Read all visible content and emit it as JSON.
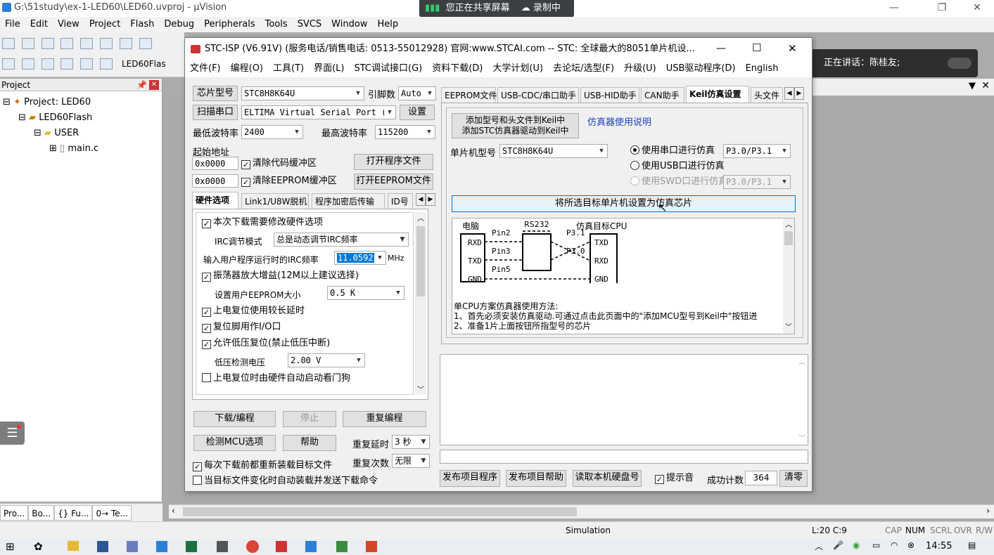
{
  "uvision": {
    "title": "G:\\51study\\ex-1-LED60\\LED60.uvproj - µVision",
    "menu": [
      "File",
      "Edit",
      "View",
      "Project",
      "Flash",
      "Debug",
      "Peripherals",
      "Tools",
      "SVCS",
      "Window",
      "Help"
    ],
    "target": "LED60Flas",
    "project_panel_title": "Project",
    "tree": [
      "Project: LED60",
      "LED60Flash",
      "USER",
      "main.c"
    ],
    "bottom_tabs": [
      "Pro...",
      "Bo...",
      "{} Fu...",
      "0→ Te..."
    ],
    "status": {
      "sim": "Simulation",
      "pos": "L:20 C:9",
      "keys": [
        "CAP",
        "NUM",
        "SCRL",
        "OVR",
        "R/W"
      ]
    }
  },
  "share": {
    "text": "您正在共享屏幕",
    "rec": "录制中"
  },
  "speaker": {
    "text": "正在讲话：陈桂友;"
  },
  "isp": {
    "title": "STC-ISP (V6.91V) (服务电话/销售电话: 0513-55012928) 官网:www.STCAI.com  -- STC: 全球最大的8051单片机设...",
    "menu": [
      "文件(F)",
      "编程(O)",
      "工具(T)",
      "界面(L)",
      "STC调试接口(G)",
      "资料下载(D)",
      "大学计划(U)",
      "去论坛/选型(F)",
      "升级(U)",
      "USB驱动程序(D)",
      "English"
    ],
    "chip_btn": "芯片型号",
    "chip": "STC8H8K64U",
    "pin_label": "引脚数",
    "pin": "Auto",
    "scan_btn": "扫描串口",
    "port": "ELTIMA Virtual Serial Port (CO",
    "settings_btn": "设置",
    "min_baud_label": "最低波特率",
    "min_baud": "2400",
    "max_baud_label": "最高波特率",
    "max_baud": "115200",
    "start_addr_label": "起始地址",
    "addr1": "0x0000",
    "clear_code": "清除代码缓冲区",
    "open_prog": "打开程序文件",
    "addr2": "0x0000",
    "clear_eeprom": "清除EEPROM缓冲区",
    "open_eeprom": "打开EEPROM文件",
    "left_tabs": [
      "硬件选项",
      "Link1/U8W脱机",
      "程序加密后传输",
      "ID号"
    ],
    "hw": {
      "opt1": "本次下载需要修改硬件选项",
      "irc_mode_label": "IRC调节模式",
      "irc_mode": "总是动态调节IRC频率",
      "irc_freq_label": "输入用户程序运行时的IRC频率",
      "irc_freq": "11.0592",
      "mhz": "MHz",
      "opt2": "振荡器放大增益(12M以上建议选择)",
      "eeprom_label": "设置用户EEPROM大小",
      "eeprom": "0.5 K",
      "opt3": "上电复位使用较长延时",
      "opt4": "复位脚用作I/O口",
      "opt5": "允许低压复位(禁止低压中断)",
      "lv_label": "低压检测电压",
      "lv": "2.00 V",
      "opt6": "上电复位时由硬件自动启动看门狗"
    },
    "download_btn": "下载/编程",
    "stop_btn": "停止",
    "reprog_btn": "重复编程",
    "detect_btn": "检测MCU选项",
    "help_btn": "帮助",
    "delay_label": "重复延时",
    "delay": "3 秒",
    "count_label": "重复次数",
    "count": "无限",
    "reload1": "每次下载前都重新装载目标文件",
    "reload2": "当目标文件变化时自动装载并发送下载命令",
    "right_tabs": [
      "EEPROM文件",
      "USB-CDC/串口助手",
      "USB-HID助手",
      "CAN助手",
      "Keil仿真设置",
      "头文件"
    ],
    "keil": {
      "add_btn_l1": "添加型号和头文件到Keil中",
      "add_btn_l2": "添加STC仿真器驱动到Keil中",
      "manual_link": "仿真器使用说明",
      "mcu_label": "单片机型号",
      "mcu": "STC8H8K64U",
      "r1": "使用串口进行仿真",
      "r1_port": "P3.0/P3.1",
      "r2": "使用USB口进行仿真",
      "r3": "使用SWD口进行仿真",
      "r3_port": "P3.0/P3.1",
      "set_btn": "将所选目标单片机设置为仿真芯片",
      "diag": {
        "pc": "电脑",
        "rs232": "RS232",
        "cpu": "仿真目标CPU",
        "rxd": "RXD",
        "txd": "TXD",
        "gnd": "GND",
        "pin2": "Pin2",
        "pin3": "Pin3",
        "pin5": "Pin5",
        "p31": "P3.1",
        "p30": "P3.0"
      },
      "note_title": "单CPU方案仿真器使用方法:",
      "note1": "1、首先必须安装仿真驱动.可通过点击此页面中的\"添加MCU型号到Keil中\"按钮进",
      "note2": "2、准备1片上面按钮所指型号的芯片"
    },
    "publish_prog": "发布项目程序",
    "publish_help": "发布项目帮助",
    "read_disk": "读取本机硬盘号",
    "beep": "提示音",
    "success_label": "成功计数",
    "success": "364",
    "clear": "清零"
  },
  "taskbar": {
    "time": "14:55"
  }
}
